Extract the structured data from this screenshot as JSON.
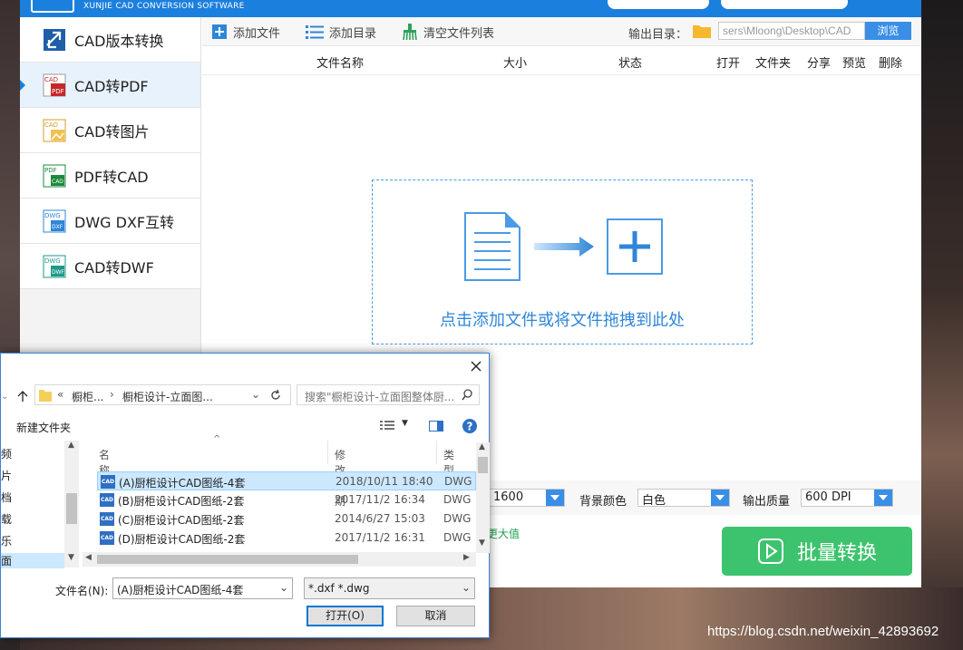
{
  "app": {
    "brand": "XUNJIE CAD CONVERSION SOFTWARE",
    "accent": "#1b7fdd",
    "nav": [
      {
        "label": "CAD版本转换",
        "icon": "cad-version-icon"
      },
      {
        "label": "CAD转PDF",
        "icon": "cad-to-pdf-icon",
        "active": true
      },
      {
        "label": "CAD转图片",
        "icon": "cad-to-image-icon"
      },
      {
        "label": "PDF转CAD",
        "icon": "pdf-to-cad-icon"
      },
      {
        "label": "DWG DXF互转",
        "icon": "dwg-dxf-icon"
      },
      {
        "label": "CAD转DWF",
        "icon": "cad-to-dwf-icon"
      }
    ],
    "toolbar": {
      "add_file": "添加文件",
      "add_dir": "添加目录",
      "clear_list": "清空文件列表",
      "output_label": "输出目录：",
      "output_path": "sers\\Mloong\\Desktop\\CAD",
      "browse": "浏览"
    },
    "columns": {
      "name": "文件名称",
      "size": "大小",
      "status": "状态",
      "open": "打开",
      "folder": "文件夹",
      "share": "分享",
      "preview": "预览",
      "delete": "删除"
    },
    "dropzone_text": "点击添加文件或将文件拖拽到此处",
    "settings": {
      "size_value": "1600",
      "bg_label": "背景颜色",
      "bg_value": "白色",
      "quality_label": "输出质量",
      "quality_value": "600 DPI"
    },
    "hint_partial": "更大值",
    "convert_label": "批量转换",
    "convert_color": "#3dc36d"
  },
  "dialog": {
    "breadcrumb_1": "橱柜...",
    "breadcrumb_2": "橱柜设计-立面图...",
    "search_placeholder": "搜索\"橱柜设计-立面图整体厨...",
    "new_folder": "新建文件夹",
    "tree": [
      "频",
      "片",
      "档",
      "载",
      "乐",
      "面"
    ],
    "col_name": "名称",
    "col_date": "修改日期",
    "col_type": "类型",
    "files": [
      {
        "name": "(A)厨柜设计CAD图纸-4套",
        "date": "2018/10/11 18:40",
        "type": "DWG",
        "selected": true
      },
      {
        "name": "(B)厨柜设计CAD图纸-2套",
        "date": "2017/11/2 16:34",
        "type": "DWG"
      },
      {
        "name": "(C)厨柜设计CAD图纸-2套",
        "date": "2014/6/27 15:03",
        "type": "DWG"
      },
      {
        "name": "(D)厨柜设计CAD图纸-2套",
        "date": "2017/11/2 16:31",
        "type": "DWG"
      }
    ],
    "filename_label": "文件名(N):",
    "filename_value": "(A)厨柜设计CAD图纸-4套",
    "filter_value": "*.dxf *.dwg",
    "open_btn": "打开(O)",
    "cancel_btn": "取消"
  },
  "watermark": "https://blog.csdn.net/weixin_42893692"
}
